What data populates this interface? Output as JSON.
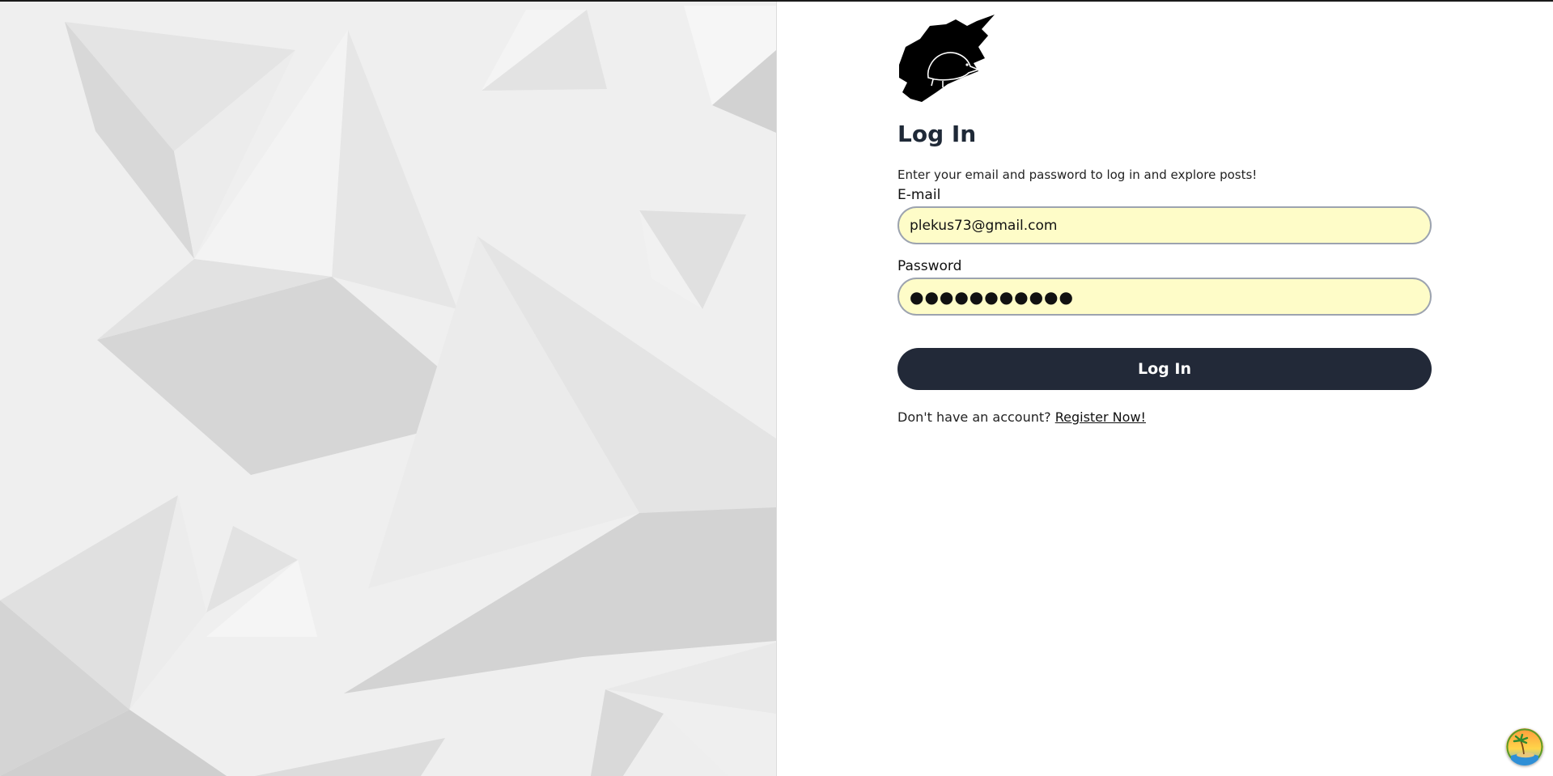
{
  "form": {
    "title": "Log In",
    "subtitle": "Enter your email and password to log in and explore posts!",
    "email_label": "E-mail",
    "email_value": "plekus73@gmail.com",
    "password_label": "Password",
    "password_value": "●●●●●●●●●●●",
    "submit_label": "Log In",
    "register_prompt": "Don't have an account?",
    "register_link": "Register Now!"
  },
  "icons": {
    "logo": "hedgehog-logo-icon",
    "corner": "island-badge-icon"
  },
  "colors": {
    "button": "#222938",
    "input_bg": "#fefcc8",
    "input_border": "#9ca3af",
    "art_bg": "#efefef"
  }
}
